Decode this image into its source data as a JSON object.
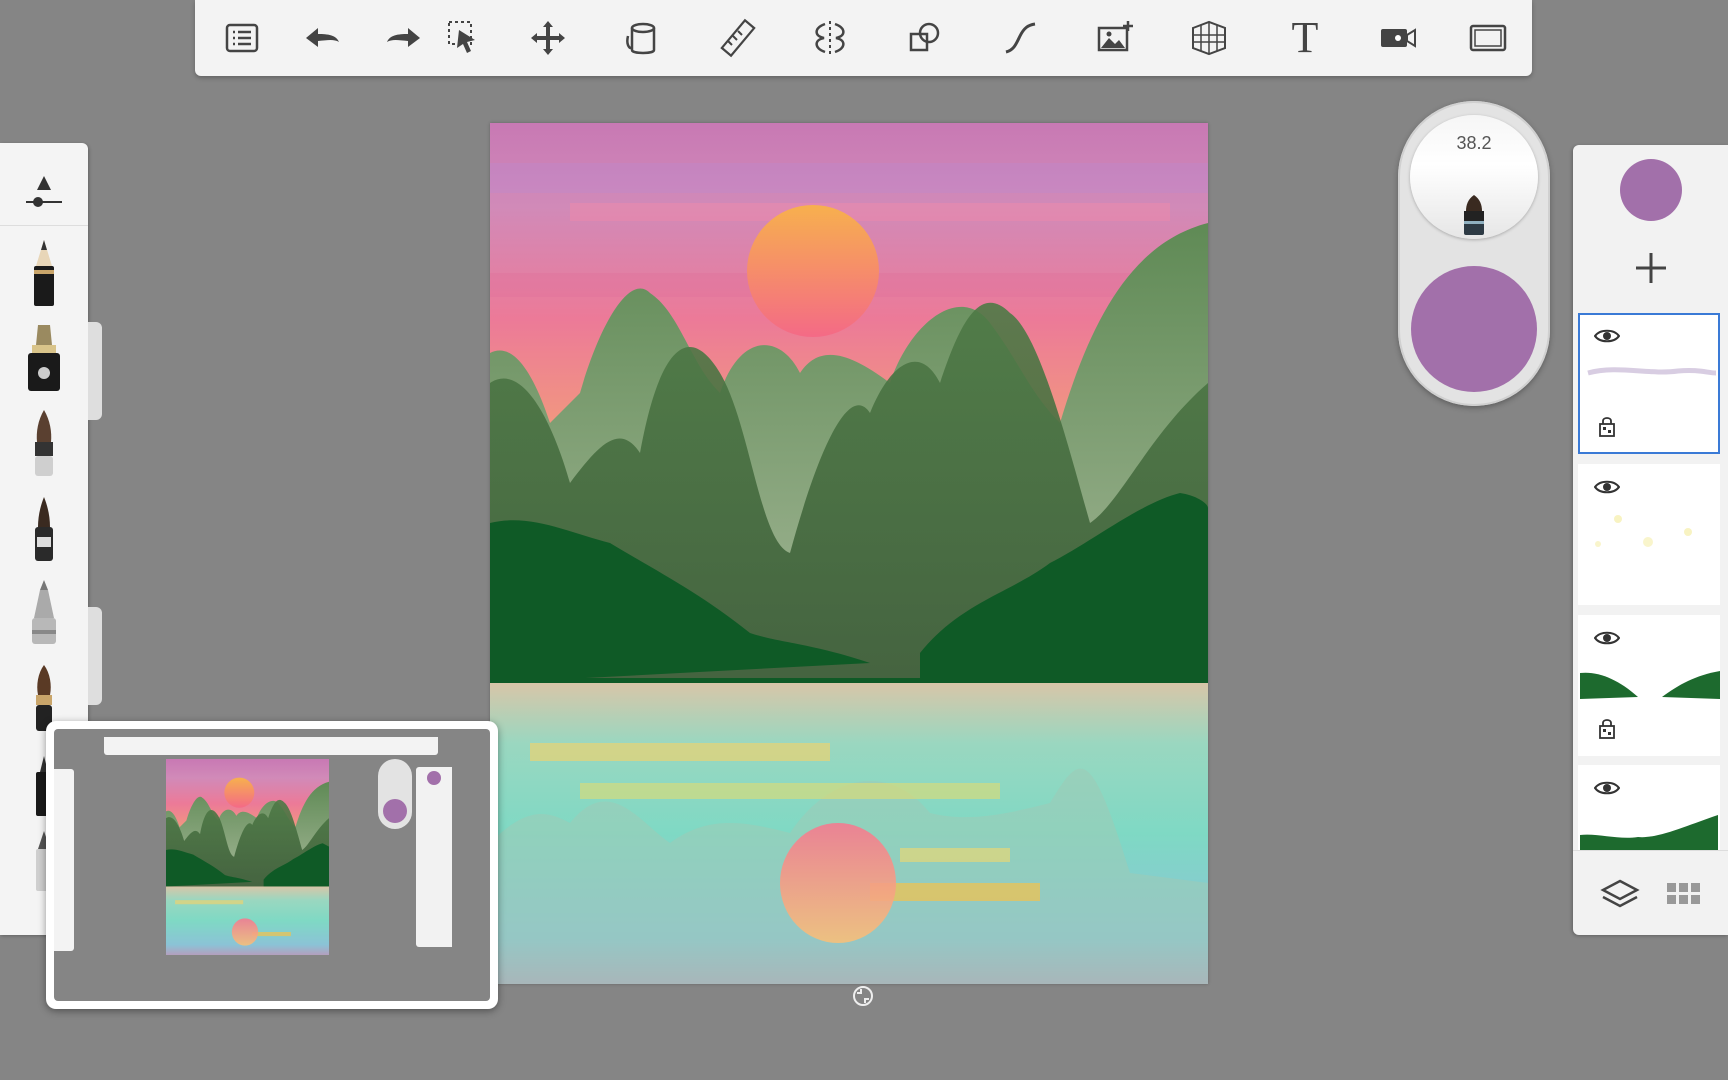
{
  "colors": {
    "background": "#858585",
    "panel": "#f3f3f3",
    "current_color": "#a270aa",
    "selection_outline": "#3a7ad6"
  },
  "toolbar": {
    "items": [
      {
        "name": "menu",
        "icon": "list-icon"
      },
      {
        "name": "undo",
        "icon": "undo-arrow-icon"
      },
      {
        "name": "redo",
        "icon": "redo-arrow-icon"
      },
      {
        "name": "select",
        "icon": "selection-icon"
      },
      {
        "name": "transform",
        "icon": "move-icon"
      },
      {
        "name": "fill",
        "icon": "paint-bucket-icon"
      },
      {
        "name": "ruler",
        "icon": "ruler-icon"
      },
      {
        "name": "symmetry",
        "icon": "symmetry-icon"
      },
      {
        "name": "shapes",
        "icon": "shapes-icon"
      },
      {
        "name": "curve",
        "icon": "curve-icon"
      },
      {
        "name": "add-image",
        "icon": "add-image-icon"
      },
      {
        "name": "perspective",
        "icon": "perspective-grid-icon"
      },
      {
        "name": "text",
        "icon": "text-icon",
        "label": "T"
      },
      {
        "name": "time-lapse",
        "icon": "video-camera-icon"
      },
      {
        "name": "fullscreen",
        "icon": "fullscreen-icon"
      }
    ]
  },
  "brush_puck": {
    "size_value": "38.2",
    "color": "#a270aa"
  },
  "brushes": [
    "brush-properties-icon",
    "pencil-brush-icon",
    "ink-pen-brush-icon",
    "paintbrush-icon",
    "marker-brush-icon",
    "airbrush-icon",
    "flat-brush-icon"
  ],
  "layers": {
    "items": [
      {
        "name": "layer-1",
        "visible": true,
        "locked": true,
        "selected": true
      },
      {
        "name": "layer-2",
        "visible": true,
        "locked": false,
        "selected": false
      },
      {
        "name": "layer-3",
        "visible": true,
        "locked": true,
        "selected": false
      },
      {
        "name": "layer-4",
        "visible": true,
        "locked": false,
        "selected": false
      }
    ]
  }
}
